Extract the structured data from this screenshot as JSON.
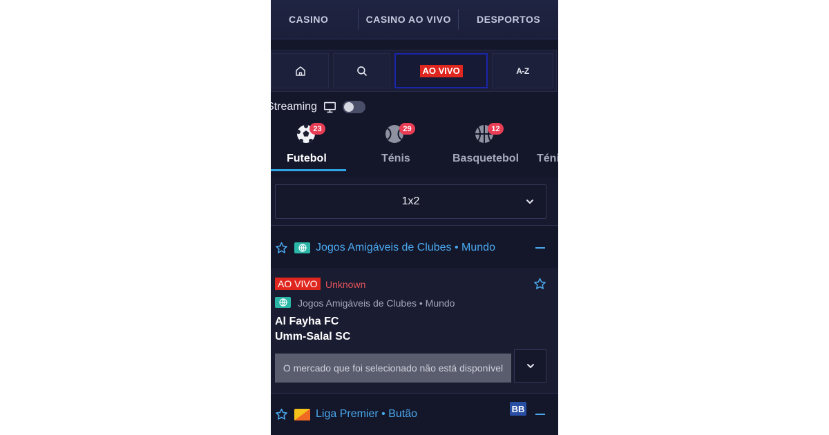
{
  "topnav": {
    "items": [
      "CASINO",
      "CASINO AO VIVO",
      "DESPORTOS"
    ]
  },
  "iconbar": {
    "live_label": "AO VIVO",
    "az_label": "A-Z"
  },
  "streaming": {
    "label": "Streaming",
    "enabled": false
  },
  "sports": [
    {
      "label": "Futebol",
      "count": "23",
      "icon": "soccer-ball-icon",
      "active": true
    },
    {
      "label": "Ténis",
      "count": "29",
      "icon": "tennis-ball-icon",
      "active": false
    },
    {
      "label": "Basquetebol",
      "count": "12",
      "icon": "basketball-icon",
      "active": false
    },
    {
      "label": "Ténis",
      "count": "",
      "icon": "",
      "active": false
    }
  ],
  "market": {
    "selected": "1x2"
  },
  "leagues": [
    {
      "title": "Jogos Amigáveis de Clubes • Mundo",
      "icon": "globe-icon"
    },
    {
      "title": "Liga Premier • Butão",
      "icon": "bhutan-flag-icon",
      "badge": "BB"
    }
  ],
  "match": {
    "live_label": "AO VIVO",
    "status": "Unknown",
    "league": "Jogos Amigáveis de Clubes • Mundo",
    "home": "Al Fayha FC",
    "away": "Umm-Salal SC",
    "unavailable": "O mercado que foi selecionado não está disponível"
  },
  "colors": {
    "accent": "#2fa4e7",
    "live": "#e0271f",
    "badge": "#e83d55",
    "league_text": "#4aa9ee",
    "background": "#14162a"
  }
}
